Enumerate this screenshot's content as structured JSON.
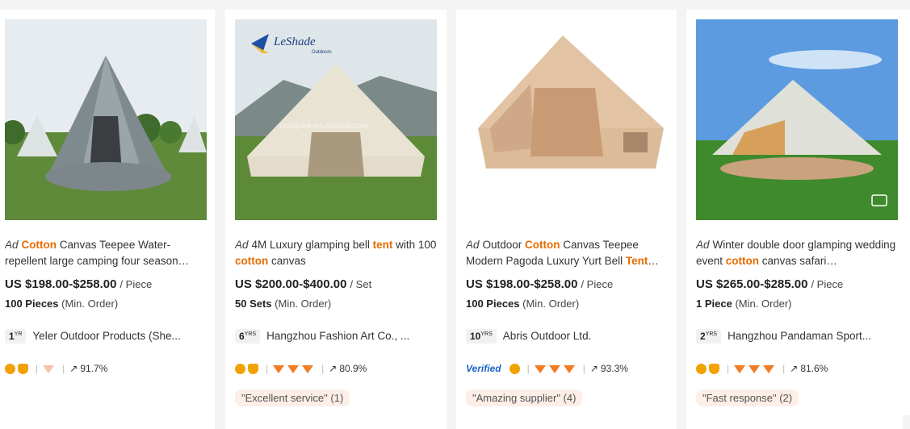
{
  "products": [
    {
      "title": [
        {
          "text": "Ad",
          "style": "ad"
        },
        {
          "text": "Cotton",
          "style": "hl"
        },
        {
          "text": " Canvas Teepee Water-repellent large camping four season…",
          "style": "n"
        }
      ],
      "price": "US $198.00-$258.00",
      "unit": "/ Piece",
      "moq_qty": "100 Pieces",
      "moq_label": "(Min. Order)",
      "years": "1",
      "years_suffix": "YR",
      "supplier": "Yeler Outdoor Products (She...",
      "verified": "",
      "medals": 2,
      "diamonds": 1,
      "diamond_pale": true,
      "response_rate": "91.7%",
      "review": ""
    },
    {
      "title": [
        {
          "text": "Ad",
          "style": "ad"
        },
        {
          "text": "4M Luxury glamping bell ",
          "style": "n"
        },
        {
          "text": "tent",
          "style": "hl"
        },
        {
          "text": " with 100 ",
          "style": "n"
        },
        {
          "text": "cotton",
          "style": "hl"
        },
        {
          "text": " canvas",
          "style": "n"
        }
      ],
      "price": "US $200.00-$400.00",
      "unit": "/ Set",
      "moq_qty": "50 Sets",
      "moq_label": "(Min. Order)",
      "years": "6",
      "years_suffix": "YRS",
      "supplier": "Hangzhou Fashion Art Co., ...",
      "verified": "",
      "medals": 2,
      "diamonds": 3,
      "diamond_pale": false,
      "response_rate": "80.9%",
      "review": "\"Excellent service\" (1)"
    },
    {
      "title": [
        {
          "text": "Ad",
          "style": "ad"
        },
        {
          "text": "Outdoor ",
          "style": "n"
        },
        {
          "text": "Cotton",
          "style": "hl"
        },
        {
          "text": " Canvas Teepee Modern Pagoda Luxury Yurt Bell ",
          "style": "n"
        },
        {
          "text": "Tent",
          "style": "hl"
        },
        {
          "text": "…",
          "style": "n"
        }
      ],
      "price": "US $198.00-$258.00",
      "unit": "/ Piece",
      "moq_qty": "100 Pieces",
      "moq_label": "(Min. Order)",
      "years": "10",
      "years_suffix": "YRS",
      "supplier": "Abris Outdoor Ltd.",
      "verified": "Verified",
      "medals": 1,
      "diamonds": 3,
      "diamond_pale": false,
      "response_rate": "93.3%",
      "review": "\"Amazing supplier\" (4)"
    },
    {
      "title": [
        {
          "text": "Ad",
          "style": "ad"
        },
        {
          "text": "Winter double door glamping wedding event ",
          "style": "n"
        },
        {
          "text": "cotton",
          "style": "hl"
        },
        {
          "text": " canvas safari…",
          "style": "n"
        }
      ],
      "price": "US $265.00-$285.00",
      "unit": "/ Piece",
      "moq_qty": "1 Piece",
      "moq_label": "(Min. Order)",
      "years": "2",
      "years_suffix": "YRS",
      "supplier": "Hangzhou Pandaman Sport...",
      "verified": "",
      "medals": 2,
      "diamonds": 3,
      "diamond_pale": false,
      "response_rate": "81.6%",
      "review": "\"Fast response\" (2)"
    }
  ],
  "image_text": {
    "logo_brand": "LeShade",
    "logo_sub": "Outdoors",
    "watermark": "marquee.en.alibaba.com"
  },
  "icons": {
    "medal": "gold-medal-icon",
    "diamond": "diamond-icon",
    "share": "trend-arrow-icon",
    "video": "video-icon"
  },
  "colors": {
    "highlight": "#e66b00",
    "diamond": "#f07d23",
    "verified": "#1a63c7",
    "review_bg": "#fdeee7"
  }
}
